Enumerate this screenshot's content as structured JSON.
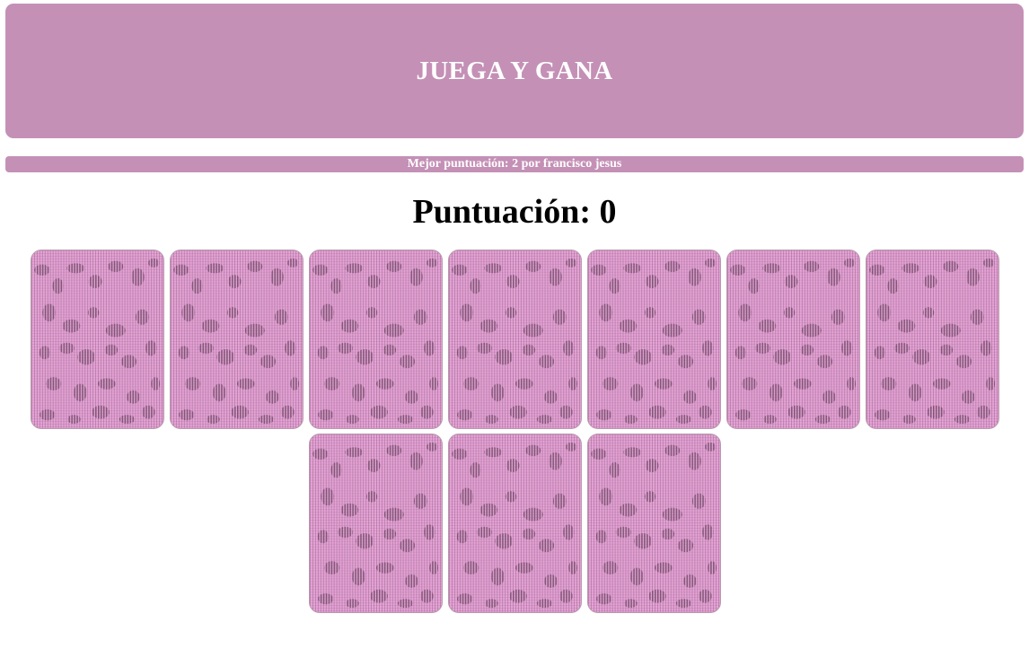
{
  "header": {
    "title": "JUEGA Y GANA"
  },
  "best_score": {
    "text": "Mejor puntuación: 2 por francisco jesus"
  },
  "score": {
    "text": "Puntuación: 0"
  },
  "board": {
    "card_back_color": "#e8a4d8",
    "card_pattern_color": "#6e4a66",
    "cards": [
      {
        "state": "face-down"
      },
      {
        "state": "face-down"
      },
      {
        "state": "face-down"
      },
      {
        "state": "face-down"
      },
      {
        "state": "face-down"
      },
      {
        "state": "face-down"
      },
      {
        "state": "face-down"
      },
      {
        "state": "face-down"
      },
      {
        "state": "face-down"
      },
      {
        "state": "face-down"
      }
    ]
  },
  "colors": {
    "accent": "#c490b6",
    "text_on_accent": "#ffffff"
  }
}
